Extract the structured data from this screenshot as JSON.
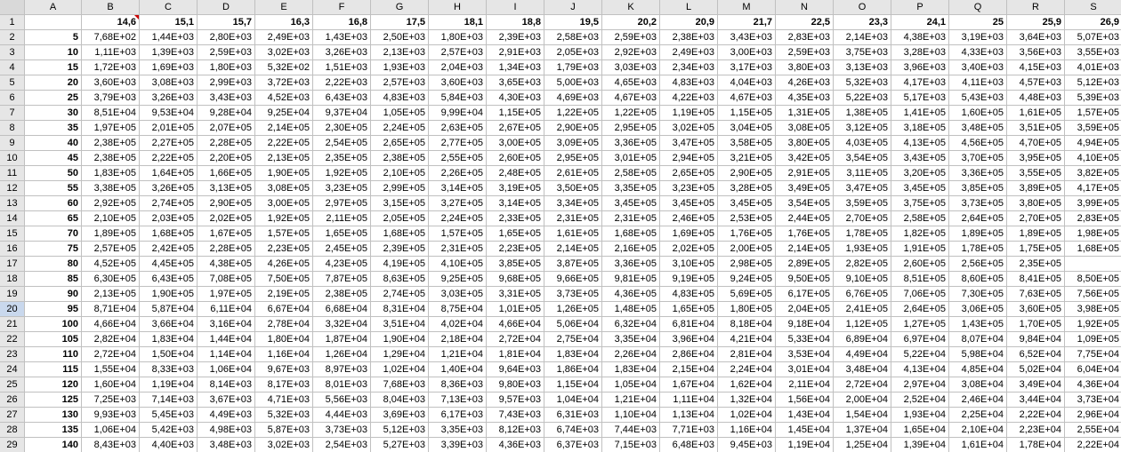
{
  "columns": [
    "A",
    "B",
    "C",
    "D",
    "E",
    "F",
    "G",
    "H",
    "I",
    "J",
    "K",
    "L",
    "M",
    "N",
    "O",
    "P",
    "Q",
    "R",
    "S"
  ],
  "rowNums": [
    "1",
    "2",
    "3",
    "4",
    "5",
    "6",
    "7",
    "8",
    "9",
    "10",
    "11",
    "12",
    "13",
    "14",
    "15",
    "16",
    "17",
    "18",
    "19",
    "20",
    "21",
    "22",
    "23",
    "24",
    "25",
    "26",
    "27",
    "28",
    "29"
  ],
  "selectedRow": 20,
  "markerCell": "B1",
  "rows": [
    {
      "a": "",
      "vals": [
        "14,6",
        "15,1",
        "15,7",
        "16,3",
        "16,8",
        "17,5",
        "18,1",
        "18,8",
        "19,5",
        "20,2",
        "20,9",
        "21,7",
        "22,5",
        "23,3",
        "24,1",
        "25",
        "25,9",
        "26,9"
      ],
      "boldVals": true
    },
    {
      "a": "5",
      "vals": [
        "7,68E+02",
        "1,44E+03",
        "2,80E+03",
        "2,49E+03",
        "1,43E+03",
        "2,50E+03",
        "1,80E+03",
        "2,39E+03",
        "2,58E+03",
        "2,59E+03",
        "2,38E+03",
        "3,43E+03",
        "2,83E+03",
        "2,14E+03",
        "4,38E+03",
        "3,19E+03",
        "3,64E+03",
        "5,07E+03"
      ]
    },
    {
      "a": "10",
      "vals": [
        "1,11E+03",
        "1,39E+03",
        "2,59E+03",
        "3,02E+03",
        "3,26E+03",
        "2,13E+03",
        "2,57E+03",
        "2,91E+03",
        "2,05E+03",
        "2,92E+03",
        "2,49E+03",
        "3,00E+03",
        "2,59E+03",
        "3,75E+03",
        "3,28E+03",
        "4,33E+03",
        "3,56E+03",
        "3,55E+03"
      ]
    },
    {
      "a": "15",
      "vals": [
        "1,72E+03",
        "1,69E+03",
        "1,80E+03",
        "5,32E+02",
        "1,51E+03",
        "1,93E+03",
        "2,04E+03",
        "1,34E+03",
        "1,79E+03",
        "3,03E+03",
        "2,34E+03",
        "3,17E+03",
        "3,80E+03",
        "3,13E+03",
        "3,96E+03",
        "3,40E+03",
        "4,15E+03",
        "4,01E+03"
      ]
    },
    {
      "a": "20",
      "vals": [
        "3,60E+03",
        "3,08E+03",
        "2,99E+03",
        "3,72E+03",
        "2,22E+03",
        "2,57E+03",
        "3,60E+03",
        "3,65E+03",
        "5,00E+03",
        "4,65E+03",
        "4,83E+03",
        "4,04E+03",
        "4,26E+03",
        "5,32E+03",
        "4,17E+03",
        "4,11E+03",
        "4,57E+03",
        "5,12E+03"
      ]
    },
    {
      "a": "25",
      "vals": [
        "3,79E+03",
        "3,26E+03",
        "3,43E+03",
        "4,52E+03",
        "6,43E+03",
        "4,83E+03",
        "5,84E+03",
        "4,30E+03",
        "4,69E+03",
        "4,67E+03",
        "4,22E+03",
        "4,67E+03",
        "4,35E+03",
        "5,22E+03",
        "5,17E+03",
        "5,43E+03",
        "4,48E+03",
        "5,39E+03"
      ]
    },
    {
      "a": "30",
      "vals": [
        "8,51E+04",
        "9,53E+04",
        "9,28E+04",
        "9,25E+04",
        "9,37E+04",
        "1,05E+05",
        "9,99E+04",
        "1,15E+05",
        "1,22E+05",
        "1,22E+05",
        "1,19E+05",
        "1,15E+05",
        "1,31E+05",
        "1,38E+05",
        "1,41E+05",
        "1,60E+05",
        "1,61E+05",
        "1,57E+05"
      ]
    },
    {
      "a": "35",
      "vals": [
        "1,97E+05",
        "2,01E+05",
        "2,07E+05",
        "2,14E+05",
        "2,30E+05",
        "2,24E+05",
        "2,63E+05",
        "2,67E+05",
        "2,90E+05",
        "2,95E+05",
        "3,02E+05",
        "3,04E+05",
        "3,08E+05",
        "3,12E+05",
        "3,18E+05",
        "3,48E+05",
        "3,51E+05",
        "3,59E+05"
      ]
    },
    {
      "a": "40",
      "vals": [
        "2,38E+05",
        "2,27E+05",
        "2,28E+05",
        "2,22E+05",
        "2,54E+05",
        "2,65E+05",
        "2,77E+05",
        "3,00E+05",
        "3,09E+05",
        "3,36E+05",
        "3,47E+05",
        "3,58E+05",
        "3,80E+05",
        "4,03E+05",
        "4,13E+05",
        "4,56E+05",
        "4,70E+05",
        "4,94E+05"
      ]
    },
    {
      "a": "45",
      "vals": [
        "2,38E+05",
        "2,22E+05",
        "2,20E+05",
        "2,13E+05",
        "2,35E+05",
        "2,38E+05",
        "2,55E+05",
        "2,60E+05",
        "2,95E+05",
        "3,01E+05",
        "2,94E+05",
        "3,21E+05",
        "3,42E+05",
        "3,54E+05",
        "3,43E+05",
        "3,70E+05",
        "3,95E+05",
        "4,10E+05"
      ]
    },
    {
      "a": "50",
      "vals": [
        "1,83E+05",
        "1,64E+05",
        "1,66E+05",
        "1,90E+05",
        "1,92E+05",
        "2,10E+05",
        "2,26E+05",
        "2,48E+05",
        "2,61E+05",
        "2,58E+05",
        "2,65E+05",
        "2,90E+05",
        "2,91E+05",
        "3,11E+05",
        "3,20E+05",
        "3,36E+05",
        "3,55E+05",
        "3,82E+05"
      ]
    },
    {
      "a": "55",
      "vals": [
        "3,38E+05",
        "3,26E+05",
        "3,13E+05",
        "3,08E+05",
        "3,23E+05",
        "2,99E+05",
        "3,14E+05",
        "3,19E+05",
        "3,50E+05",
        "3,35E+05",
        "3,23E+05",
        "3,28E+05",
        "3,49E+05",
        "3,47E+05",
        "3,45E+05",
        "3,85E+05",
        "3,89E+05",
        "4,17E+05"
      ]
    },
    {
      "a": "60",
      "vals": [
        "2,92E+05",
        "2,74E+05",
        "2,90E+05",
        "3,00E+05",
        "2,97E+05",
        "3,15E+05",
        "3,27E+05",
        "3,14E+05",
        "3,34E+05",
        "3,45E+05",
        "3,45E+05",
        "3,45E+05",
        "3,54E+05",
        "3,59E+05",
        "3,75E+05",
        "3,73E+05",
        "3,80E+05",
        "3,99E+05"
      ]
    },
    {
      "a": "65",
      "vals": [
        "2,10E+05",
        "2,03E+05",
        "2,02E+05",
        "1,92E+05",
        "2,11E+05",
        "2,05E+05",
        "2,24E+05",
        "2,33E+05",
        "2,31E+05",
        "2,31E+05",
        "2,46E+05",
        "2,53E+05",
        "2,44E+05",
        "2,70E+05",
        "2,58E+05",
        "2,64E+05",
        "2,70E+05",
        "2,83E+05"
      ]
    },
    {
      "a": "70",
      "vals": [
        "1,89E+05",
        "1,68E+05",
        "1,67E+05",
        "1,57E+05",
        "1,65E+05",
        "1,68E+05",
        "1,57E+05",
        "1,65E+05",
        "1,61E+05",
        "1,68E+05",
        "1,69E+05",
        "1,76E+05",
        "1,76E+05",
        "1,78E+05",
        "1,82E+05",
        "1,89E+05",
        "1,89E+05",
        "1,98E+05"
      ]
    },
    {
      "a": "75",
      "vals": [
        "2,57E+05",
        "2,42E+05",
        "2,28E+05",
        "2,23E+05",
        "2,45E+05",
        "2,39E+05",
        "2,31E+05",
        "2,23E+05",
        "2,14E+05",
        "2,16E+05",
        "2,02E+05",
        "2,00E+05",
        "2,14E+05",
        "1,93E+05",
        "1,91E+05",
        "1,78E+05",
        "1,75E+05",
        "1,68E+05"
      ]
    },
    {
      "a": "80",
      "vals": [
        "4,52E+05",
        "4,45E+05",
        "4,38E+05",
        "4,26E+05",
        "4,23E+05",
        "4,19E+05",
        "4,10E+05",
        "3,85E+05",
        "3,87E+05",
        "3,36E+05",
        "3,10E+05",
        "2,98E+05",
        "2,89E+05",
        "2,82E+05",
        "2,60E+05",
        "2,56E+05",
        "2,35E+05"
      ]
    },
    {
      "a": "85",
      "vals": [
        "6,30E+05",
        "6,43E+05",
        "7,08E+05",
        "7,50E+05",
        "7,87E+05",
        "8,63E+05",
        "9,25E+05",
        "9,68E+05",
        "9,66E+05",
        "9,81E+05",
        "9,19E+05",
        "9,24E+05",
        "9,50E+05",
        "9,10E+05",
        "8,51E+05",
        "8,60E+05",
        "8,41E+05",
        "8,50E+05"
      ]
    },
    {
      "a": "90",
      "vals": [
        "2,13E+05",
        "1,90E+05",
        "1,97E+05",
        "2,19E+05",
        "2,38E+05",
        "2,74E+05",
        "3,03E+05",
        "3,31E+05",
        "3,73E+05",
        "4,36E+05",
        "4,83E+05",
        "5,69E+05",
        "6,17E+05",
        "6,76E+05",
        "7,06E+05",
        "7,30E+05",
        "7,63E+05",
        "7,56E+05"
      ]
    },
    {
      "a": "95",
      "vals": [
        "8,71E+04",
        "5,87E+04",
        "6,11E+04",
        "6,67E+04",
        "6,68E+04",
        "8,31E+04",
        "8,75E+04",
        "1,01E+05",
        "1,26E+05",
        "1,48E+05",
        "1,65E+05",
        "1,80E+05",
        "2,04E+05",
        "2,41E+05",
        "2,64E+05",
        "3,06E+05",
        "3,60E+05",
        "3,98E+05"
      ]
    },
    {
      "a": "100",
      "vals": [
        "4,66E+04",
        "3,66E+04",
        "3,16E+04",
        "2,78E+04",
        "3,32E+04",
        "3,51E+04",
        "4,02E+04",
        "4,66E+04",
        "5,06E+04",
        "6,32E+04",
        "6,81E+04",
        "8,18E+04",
        "9,18E+04",
        "1,12E+05",
        "1,27E+05",
        "1,43E+05",
        "1,70E+05",
        "1,92E+05"
      ]
    },
    {
      "a": "105",
      "vals": [
        "2,82E+04",
        "1,83E+04",
        "1,44E+04",
        "1,80E+04",
        "1,87E+04",
        "1,90E+04",
        "2,18E+04",
        "2,72E+04",
        "2,75E+04",
        "3,35E+04",
        "3,96E+04",
        "4,21E+04",
        "5,33E+04",
        "6,89E+04",
        "6,97E+04",
        "8,07E+04",
        "9,84E+04",
        "1,09E+05"
      ]
    },
    {
      "a": "110",
      "vals": [
        "2,72E+04",
        "1,50E+04",
        "1,14E+04",
        "1,16E+04",
        "1,26E+04",
        "1,29E+04",
        "1,21E+04",
        "1,81E+04",
        "1,83E+04",
        "2,26E+04",
        "2,86E+04",
        "2,81E+04",
        "3,53E+04",
        "4,49E+04",
        "5,22E+04",
        "5,98E+04",
        "6,52E+04",
        "7,75E+04"
      ]
    },
    {
      "a": "115",
      "vals": [
        "1,55E+04",
        "8,33E+03",
        "1,06E+04",
        "9,67E+03",
        "8,97E+03",
        "1,02E+04",
        "1,40E+04",
        "9,64E+03",
        "1,86E+04",
        "1,83E+04",
        "2,15E+04",
        "2,24E+04",
        "3,01E+04",
        "3,48E+04",
        "4,13E+04",
        "4,85E+04",
        "5,02E+04",
        "6,04E+04"
      ]
    },
    {
      "a": "120",
      "vals": [
        "1,60E+04",
        "1,19E+04",
        "8,14E+03",
        "8,17E+03",
        "8,01E+03",
        "7,68E+03",
        "8,36E+03",
        "9,80E+03",
        "1,15E+04",
        "1,05E+04",
        "1,67E+04",
        "1,62E+04",
        "2,11E+04",
        "2,72E+04",
        "2,97E+04",
        "3,08E+04",
        "3,49E+04",
        "4,36E+04"
      ]
    },
    {
      "a": "125",
      "vals": [
        "7,25E+03",
        "7,14E+03",
        "3,67E+03",
        "4,71E+03",
        "5,56E+03",
        "8,04E+03",
        "7,13E+03",
        "9,57E+03",
        "1,04E+04",
        "1,21E+04",
        "1,11E+04",
        "1,32E+04",
        "1,56E+04",
        "2,00E+04",
        "2,52E+04",
        "2,46E+04",
        "3,44E+04",
        "3,73E+04"
      ]
    },
    {
      "a": "130",
      "vals": [
        "9,93E+03",
        "5,45E+03",
        "4,49E+03",
        "5,32E+03",
        "4,44E+03",
        "3,69E+03",
        "6,17E+03",
        "7,43E+03",
        "6,31E+03",
        "1,10E+04",
        "1,13E+04",
        "1,02E+04",
        "1,43E+04",
        "1,54E+04",
        "1,93E+04",
        "2,25E+04",
        "2,22E+04",
        "2,96E+04"
      ]
    },
    {
      "a": "135",
      "vals": [
        "1,06E+04",
        "5,42E+03",
        "4,98E+03",
        "5,87E+03",
        "3,73E+03",
        "5,12E+03",
        "3,35E+03",
        "8,12E+03",
        "6,74E+03",
        "7,44E+03",
        "7,71E+03",
        "1,16E+04",
        "1,45E+04",
        "1,37E+04",
        "1,65E+04",
        "2,10E+04",
        "2,23E+04",
        "2,55E+04"
      ]
    },
    {
      "a": "140",
      "vals": [
        "8,43E+03",
        "4,40E+03",
        "3,48E+03",
        "3,02E+03",
        "2,54E+03",
        "5,27E+03",
        "3,39E+03",
        "4,36E+03",
        "6,37E+03",
        "7,15E+03",
        "6,48E+03",
        "9,45E+03",
        "1,19E+04",
        "1,25E+04",
        "1,39E+04",
        "1,61E+04",
        "1,78E+04",
        "2,22E+04"
      ]
    }
  ]
}
